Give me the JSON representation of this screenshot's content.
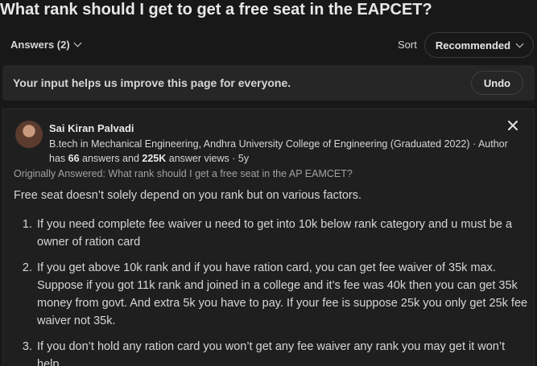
{
  "question": {
    "title": "What rank should I get to get a free seat in the EAPCET?"
  },
  "answers_tab": {
    "label": "Answers (2)"
  },
  "sort": {
    "label": "Sort",
    "value": "Recommended"
  },
  "feedback": {
    "message": "Your input helps us improve this page for everyone.",
    "undo_label": "Undo"
  },
  "answer": {
    "author_name": "Sai Kiran Palvadi",
    "credential": "B.tech in Mechanical Engineering, Andhra University College of Engineering (Graduated 2022) · Author has ",
    "answers_count": "66",
    "answers_mid": " answers and ",
    "views_count": "225K",
    "views_tail": " answer views · 5y",
    "originally_answered": "Originally Answered: What rank should I get a free seat in the AP EAMCET?",
    "intro": "Free seat doesn’t solely depend on you rank but on various factors.",
    "points": [
      "If you need complete fee waiver u need to get into 10k below rank category and u must be a owner of ration card",
      "If you get above 10k rank and if you have ration card, you can get fee waiver of 35k max. Suppose if you got 11k rank and joined in a college and it’s fee was 40k then you can get 35k money from govt. And extra 5k you have to pay. If your fee is suppose 25k you only get 25k fee waiver not 35k.",
      "If you don’t hold any ration card you won’t get any fee waiver any rank you may get it won’t help."
    ]
  },
  "icons": {
    "close": "close-icon",
    "chevron": "chevron-down-icon"
  }
}
